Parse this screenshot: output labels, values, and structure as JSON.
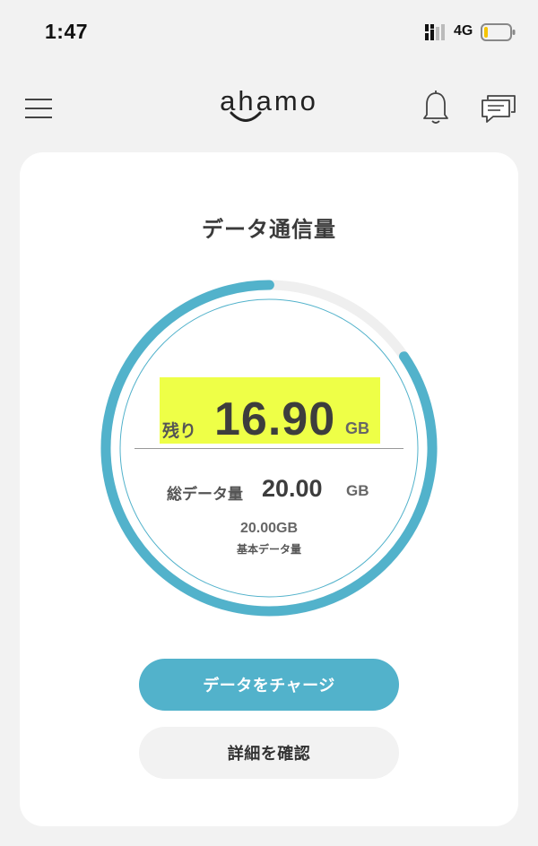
{
  "status_bar": {
    "time": "1:47",
    "network": "4G",
    "icons": [
      "signal-bars-icon",
      "battery-low-icon"
    ]
  },
  "header": {
    "logo_text": "ahamo",
    "icons": [
      "menu-icon",
      "bell-icon",
      "chat-icon"
    ]
  },
  "card": {
    "title": "データ通信量",
    "remaining": {
      "label": "残り",
      "value": "16.90",
      "unit": "GB"
    },
    "total": {
      "label": "総データ量",
      "value": "20.00",
      "unit": "GB"
    },
    "basic": {
      "value": "20.00GB",
      "label": "基本データ量"
    },
    "gauge": {
      "remaining_fraction": 0.845
    }
  },
  "buttons": {
    "charge_label": "データをチャージ",
    "detail_label": "詳細を確認"
  },
  "colors": {
    "accent": "#52b2cb",
    "highlight": "#eeff47",
    "gauge_track": "#efefef",
    "background": "#f2f2f2"
  }
}
